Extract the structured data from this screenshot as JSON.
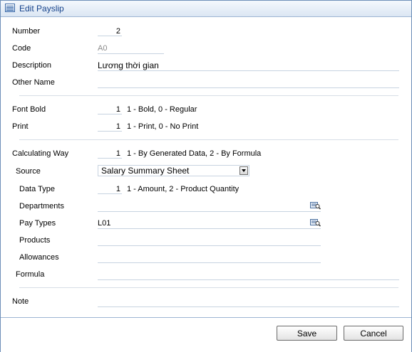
{
  "window": {
    "title": "Edit Payslip",
    "icon": "table-icon"
  },
  "fields": {
    "number": {
      "label": "Number",
      "value": "2"
    },
    "code": {
      "label": "Code",
      "value": "A0"
    },
    "description": {
      "label": "Description",
      "value": "Lương thời gian"
    },
    "other_name": {
      "label": "Other Name",
      "value": ""
    },
    "font_bold": {
      "label": "Font Bold",
      "value": "1",
      "hint": "1 - Bold, 0 - Regular"
    },
    "print": {
      "label": "Print",
      "value": "1",
      "hint": "1 - Print, 0 - No Print"
    },
    "calculating_way": {
      "label": "Calculating Way",
      "value": "1",
      "hint": "1 - By Generated Data, 2 - By Formula"
    },
    "source": {
      "label": "Source",
      "value": "Salary Summary Sheet"
    },
    "data_type": {
      "label": "Data Type",
      "value": "1",
      "hint": "1 - Amount, 2 - Product Quantity"
    },
    "departments": {
      "label": "Departments",
      "value": ""
    },
    "pay_types": {
      "label": "Pay Types",
      "value": "L01"
    },
    "products": {
      "label": "Products",
      "value": ""
    },
    "allowances": {
      "label": "Allowances",
      "value": ""
    },
    "formula": {
      "label": "Formula",
      "value": ""
    },
    "note": {
      "label": "Note",
      "value": ""
    }
  },
  "buttons": {
    "save": "Save",
    "cancel": "Cancel"
  }
}
